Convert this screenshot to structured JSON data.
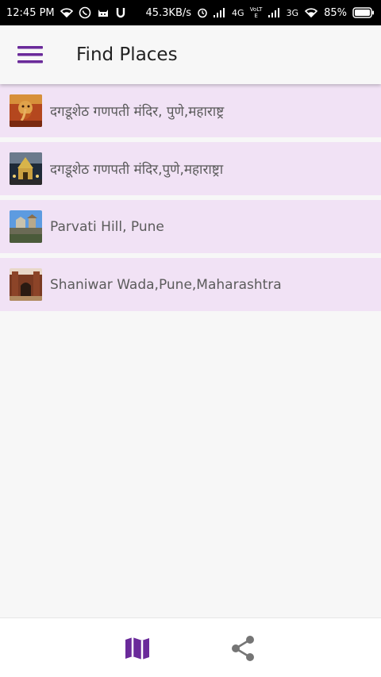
{
  "status_bar": {
    "time": "12:45 PM",
    "speed": "45.3KB/s",
    "network_4g": "4G",
    "volte": "VoLTE",
    "network_3g": "3G",
    "battery": "85%",
    "icons": [
      "wifi-icon",
      "whatsapp-icon",
      "cat-icon",
      "u-icon",
      "alarm-icon",
      "signal-icon",
      "signal-icon",
      "wifi-icon",
      "battery-icon"
    ]
  },
  "toolbar": {
    "title": "Find Places",
    "menu_icon": "hamburger-menu-icon",
    "accent_color": "#6a2a9a"
  },
  "places": [
    {
      "name": "दगडूशेठ गणपती मंदिर, पुणे,महाराष्ट्र",
      "thumbnail": "ganpati-idol-image"
    },
    {
      "name": "दगडूशेठ गणपती मंदिर,पुणे,महाराष्ट्रा",
      "thumbnail": "temple-night-image"
    },
    {
      "name": "Parvati Hill, Pune",
      "thumbnail": "parvati-hill-image"
    },
    {
      "name": "Shaniwar Wada,Pune,Maharashtra",
      "thumbnail": "shaniwar-wada-image"
    }
  ],
  "list_item_color": "#f1e2f5",
  "bottom_nav": {
    "items": [
      "map-icon",
      "share-icon"
    ],
    "active_color": "#6a2a9a",
    "inactive_color": "#757575"
  }
}
